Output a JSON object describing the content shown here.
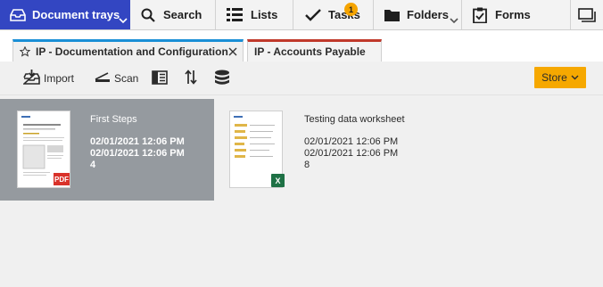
{
  "nav": {
    "document_trays": "Document trays",
    "search": "Search",
    "lists": "Lists",
    "tasks": "Tasks",
    "tasks_badge": "1",
    "folders": "Folders",
    "forms": "Forms"
  },
  "tabs": [
    {
      "label": "IP - Documentation and Configuration",
      "accent": "#1a8fd6"
    },
    {
      "label": "IP - Accounts Payable",
      "accent": "#c0392b"
    }
  ],
  "toolbar": {
    "import_label": "Import",
    "scan_label": "Scan",
    "store_label": "Store"
  },
  "documents": [
    {
      "title": "First Steps",
      "line1": "02/01/2021 12:06 PM",
      "line2": "02/01/2021 12:06 PM",
      "line3": "4",
      "file_badge": "PDF",
      "selected": true
    },
    {
      "title": "Testing data worksheet",
      "line1": "02/01/2021 12:06 PM",
      "line2": "02/01/2021 12:06 PM",
      "line3": "8",
      "file_badge": "X",
      "selected": false
    }
  ],
  "colors": {
    "nav_active": "#3346c2",
    "store_button": "#f6a800",
    "selected_card": "#959a9f",
    "tasks_badge": "#f5a400"
  }
}
